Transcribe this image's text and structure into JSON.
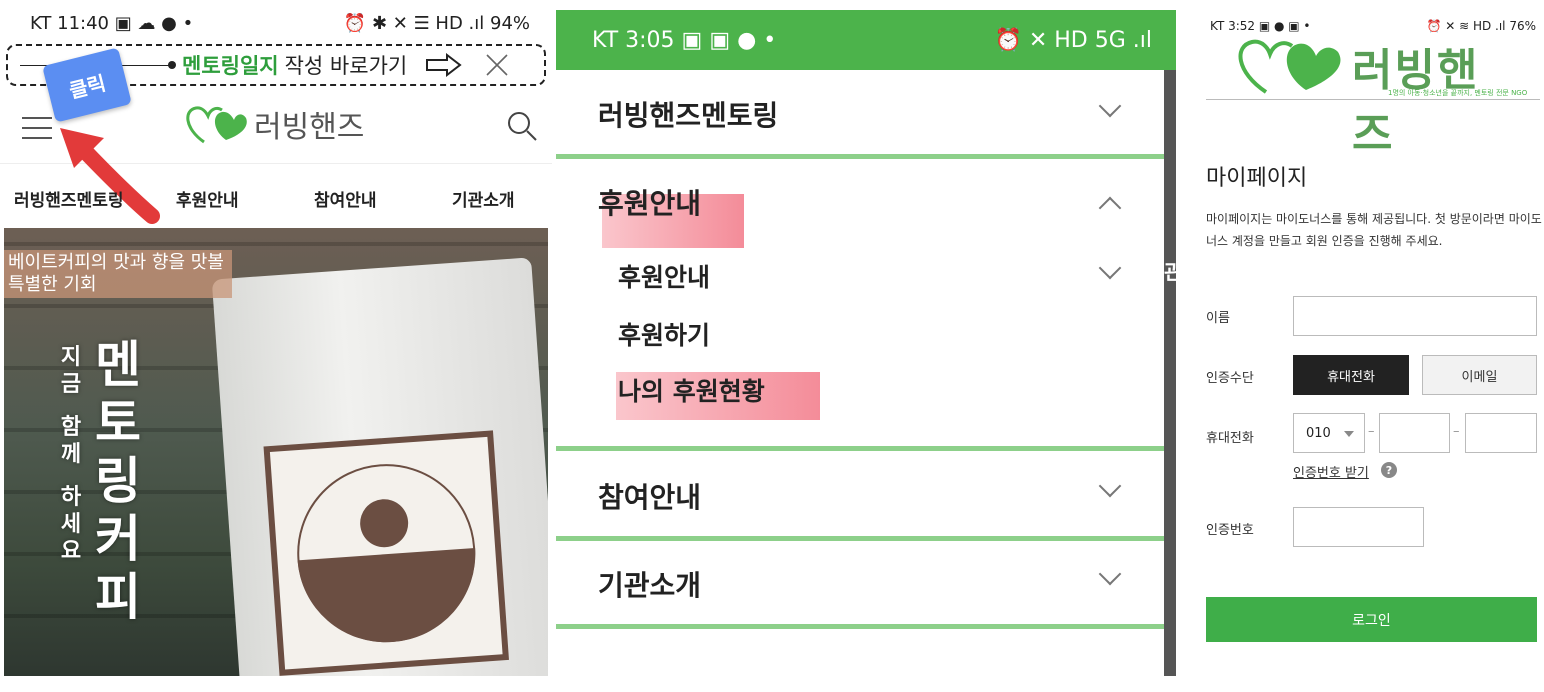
{
  "panel1": {
    "status": {
      "left": "KT 11:40 ▣ ☁ ● •",
      "right": "⏰ ✱ ✕ ☰ HD .ıl 94%"
    },
    "banner": {
      "link": "멘토링일지",
      "text": "작성 바로가기"
    },
    "click_badge": "클릭",
    "logo_text": "러빙핸즈",
    "nav": [
      "러빙핸즈멘토링",
      "후원안내",
      "참여안내",
      "기관소개"
    ],
    "hero": {
      "tag_line1": "베이트커피의 맛과 향을 맛볼",
      "tag_line2": "특별한 기회",
      "vertical_small": [
        "지",
        "금",
        "함",
        "께",
        "하",
        "세",
        "요"
      ],
      "vertical_big": [
        "멘",
        "토",
        "링",
        "커",
        "피"
      ]
    },
    "colors": {
      "accent": "#2e9e3c",
      "badge": "#5b8ef2",
      "arrow": "#e23a3a"
    }
  },
  "panel2": {
    "status": {
      "left": "KT 3:05 ▣ ▣ ● •",
      "right": "⏰ ✕ HD 5G .ıl"
    },
    "menu": [
      {
        "label": "러빙핸즈멘토링"
      },
      {
        "label": "후원안내"
      },
      {
        "label": "참여안내"
      },
      {
        "label": "기관소개"
      }
    ],
    "submenu": [
      "후원안내",
      "후원하기",
      "나의 후원현황"
    ],
    "side_glyph": "관",
    "colors": {
      "topbar": "#4cb34b",
      "divider": "#8dd08a"
    }
  },
  "panel3": {
    "status": {
      "left": "KT 3:52 ▣ ● ▣ •",
      "right": "⏰ ✕ ≋ HD .ıl 76%"
    },
    "logo_text": "러빙핸즈",
    "slogan": "1명의 아동·청소년을 끝까지, 멘토링 전문 NGO",
    "title": "마이페이지",
    "description": "마이페이지는 마이도너스를 통해 제공됩니다. 첫 방문이라면 마이도너스 계정을 만들고 회원 인증을 진행해 주세요.",
    "labels": {
      "name": "이름",
      "method": "인증수단",
      "phone": "휴대전화",
      "code": "인증번호"
    },
    "method_options": [
      "휴대전화",
      "이메일"
    ],
    "phone_prefix": "010",
    "request_code_link": "인증번호 받기",
    "help_glyph": "?",
    "login_button": "로그인",
    "colors": {
      "login": "#3fae49",
      "selected": "#222222"
    }
  }
}
